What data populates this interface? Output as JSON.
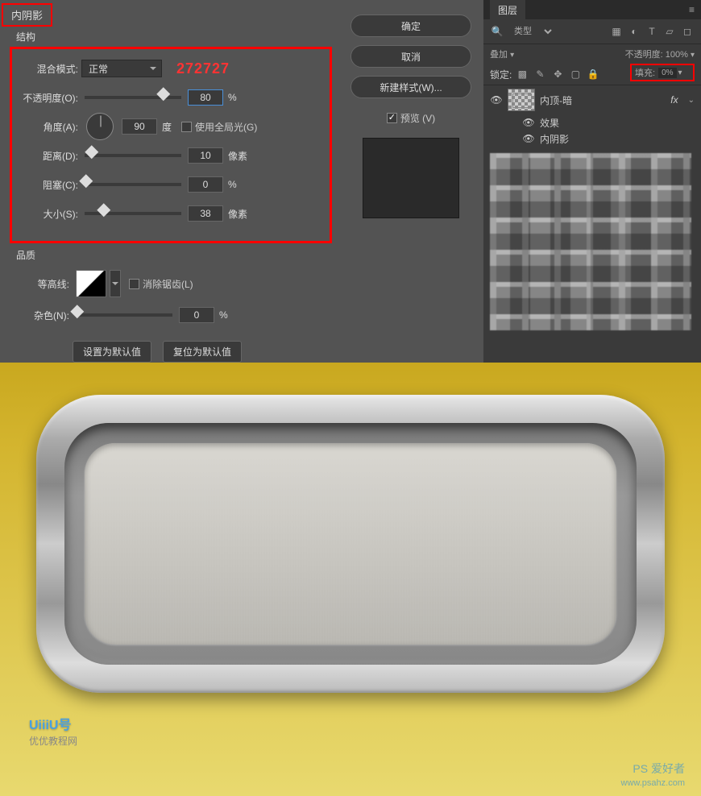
{
  "tab": {
    "title": "内阴影"
  },
  "structure": {
    "label": "结构",
    "blend_mode_label": "混合模式:",
    "blend_mode_value": "正常",
    "color_code": "272727",
    "opacity_label": "不透明度(O):",
    "opacity_value": "80",
    "opacity_unit": "%",
    "angle_label": "角度(A):",
    "angle_value": "90",
    "angle_unit": "度",
    "global_light_label": "使用全局光(G)",
    "distance_label": "距离(D):",
    "distance_value": "10",
    "distance_unit": "像素",
    "choke_label": "阻塞(C):",
    "choke_value": "0",
    "choke_unit": "%",
    "size_label": "大小(S):",
    "size_value": "38",
    "size_unit": "像素"
  },
  "quality": {
    "label": "品质",
    "contour_label": "等高线:",
    "antialias_label": "消除锯齿(L)",
    "noise_label": "杂色(N):",
    "noise_value": "0",
    "noise_unit": "%"
  },
  "buttons": {
    "set_default": "设置为默认值",
    "reset_default": "复位为默认值",
    "ok": "确定",
    "cancel": "取消",
    "new_style": "新建样式(W)...",
    "preview": "预览 (V)"
  },
  "layers_panel": {
    "title": "图层",
    "type_filter": "类型",
    "blend_mode": "叠加",
    "opacity_label": "不透明度:",
    "opacity_value": "100%",
    "lock_label": "锁定:",
    "fill_label": "填充:",
    "fill_value": "0%",
    "layer_name": "内顶-暗",
    "fx_label": "fx",
    "effects_label": "效果",
    "inner_shadow_label": "内阴影"
  },
  "watermarks": {
    "left_title": "UiiiU号",
    "left_sub": "优优教程网",
    "right_title": "PS 爱好者",
    "right_sub": "www.psahz.com"
  }
}
